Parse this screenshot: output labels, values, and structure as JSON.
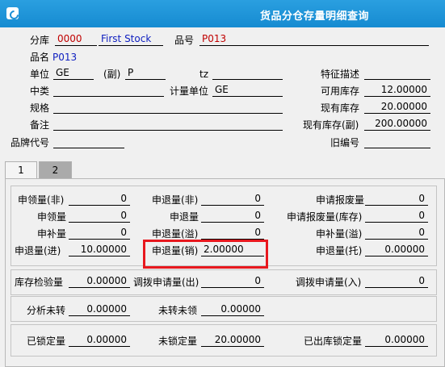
{
  "window": {
    "title": "货品分仓存量明细查询"
  },
  "header": {
    "warehouse": {
      "label": "分库",
      "code": "0000",
      "name": "First Stock"
    },
    "item_no": {
      "label": "品号",
      "value": "P013"
    },
    "item_name": {
      "label": "品名",
      "value": "P013"
    },
    "unit": {
      "label": "单位",
      "value": "GE"
    },
    "unit_secondary": {
      "label": "(副)",
      "value": "P"
    },
    "tz": {
      "label": "tz",
      "value": ""
    },
    "feature_desc": {
      "label": "特征描述",
      "value": ""
    },
    "mid_category": {
      "label": "中类",
      "value": ""
    },
    "measure_unit": {
      "label": "计量单位",
      "value": "GE"
    },
    "available_stock": {
      "label": "可用库存",
      "value": "12.00000"
    },
    "spec": {
      "label": "规格",
      "value": ""
    },
    "current_stock": {
      "label": "现有库存",
      "value": "20.00000"
    },
    "remark": {
      "label": "备注",
      "value": ""
    },
    "current_stock_secondary": {
      "label": "现有库存(副)",
      "value": "200.00000"
    },
    "brand_code": {
      "label": "品牌代号",
      "value": ""
    },
    "old_code": {
      "label": "旧编号",
      "value": ""
    }
  },
  "tabs": [
    {
      "label": "1",
      "active": false
    },
    {
      "label": "2",
      "active": true
    }
  ],
  "group1": {
    "col1": [
      {
        "label": "申领量(非)",
        "value": "0"
      },
      {
        "label": "申领量",
        "value": "0"
      },
      {
        "label": "申补量",
        "value": "0"
      },
      {
        "label": "申退量(进)",
        "value": "10.00000"
      }
    ],
    "col2": [
      {
        "label": "申退量(非)",
        "value": "0"
      },
      {
        "label": "申退量",
        "value": "0"
      },
      {
        "label": "申退量(溢)",
        "value": "0"
      },
      {
        "label": "申退量(销)",
        "value": "2.00000"
      }
    ],
    "col3": [
      {
        "label": "申请报废量",
        "value": "0"
      },
      {
        "label": "申请报废量(库存)",
        "value": "0"
      },
      {
        "label": "申补量(溢)",
        "value": "0"
      },
      {
        "label": "申退量(托)",
        "value": "0.00000"
      }
    ]
  },
  "group2": [
    {
      "label": "库存检验量",
      "value": "0.00000"
    },
    {
      "label": "调拨申请量(出)",
      "value": "0"
    },
    {
      "label": "调拨申请量(入)",
      "value": "0"
    }
  ],
  "group3": [
    {
      "label": "分析未转",
      "value": "0.00000"
    },
    {
      "label": "未转未领",
      "value": "0.00000"
    }
  ],
  "group4": [
    {
      "label": "已锁定量",
      "value": "0.00000"
    },
    {
      "label": "未锁定量",
      "value": "20.00000"
    },
    {
      "label": "已出库锁定量",
      "value": "0.00000"
    }
  ],
  "colors": {
    "titlebar": "#1a8fd6",
    "highlight": "#e8181e",
    "code_red": "#c00000",
    "link_blue": "#1020c0"
  }
}
